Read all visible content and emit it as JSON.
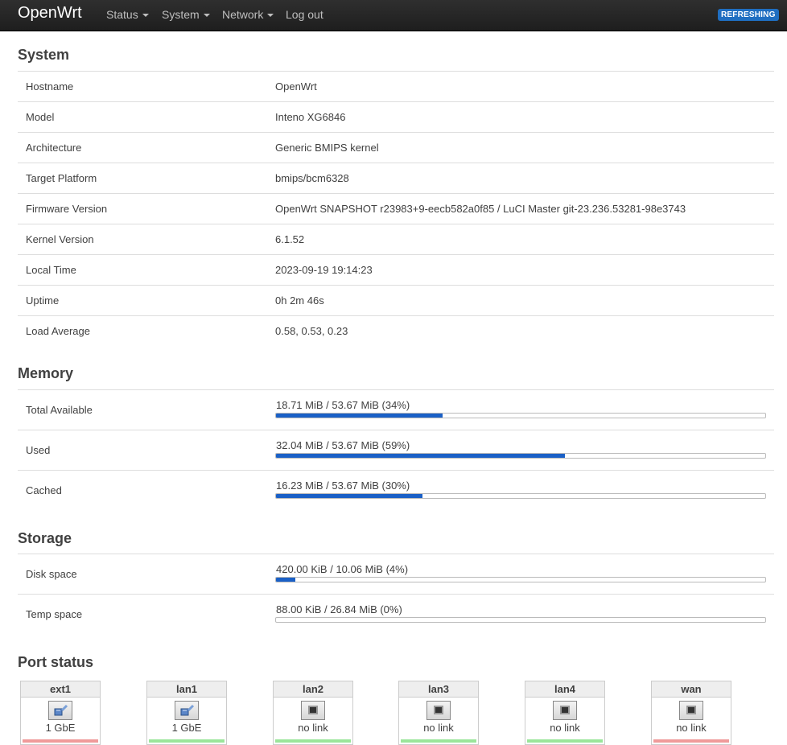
{
  "brand": "OpenWrt",
  "nav": {
    "status": "Status",
    "system": "System",
    "network": "Network",
    "logout": "Log out"
  },
  "badge": "REFRESHING",
  "system": {
    "title": "System",
    "rows": [
      {
        "key": "Hostname",
        "value": "OpenWrt"
      },
      {
        "key": "Model",
        "value": "Inteno XG6846"
      },
      {
        "key": "Architecture",
        "value": "Generic BMIPS kernel"
      },
      {
        "key": "Target Platform",
        "value": "bmips/bcm6328"
      },
      {
        "key": "Firmware Version",
        "value": "OpenWrt SNAPSHOT r23983+9-eecb582a0f85 / LuCI Master git-23.236.53281-98e3743"
      },
      {
        "key": "Kernel Version",
        "value": "6.1.52"
      },
      {
        "key": "Local Time",
        "value": "2023-09-19 19:14:23"
      },
      {
        "key": "Uptime",
        "value": "0h 2m 46s"
      },
      {
        "key": "Load Average",
        "value": "0.58, 0.53, 0.23"
      }
    ]
  },
  "memory": {
    "title": "Memory",
    "rows": [
      {
        "key": "Total Available",
        "value": "18.71 MiB / 53.67 MiB (34%)",
        "fraction": 0.34
      },
      {
        "key": "Used",
        "value": "32.04 MiB / 53.67 MiB (59%)",
        "fraction": 0.59
      },
      {
        "key": "Cached",
        "value": "16.23 MiB / 53.67 MiB (30%)",
        "fraction": 0.3
      }
    ]
  },
  "storage": {
    "title": "Storage",
    "rows": [
      {
        "key": "Disk space",
        "value": "420.00 KiB / 10.06 MiB (4%)",
        "fraction": 0.04
      },
      {
        "key": "Temp space",
        "value": "88.00 KiB / 26.84 MiB (0%)",
        "fraction": 0.0
      }
    ]
  },
  "ports": {
    "title": "Port status",
    "items": [
      {
        "name": "ext1",
        "speed": "1 GbE",
        "icon": "ethernet-connected-icon",
        "status_color": "#f09a9a"
      },
      {
        "name": "lan1",
        "speed": "1 GbE",
        "icon": "ethernet-connected-icon",
        "status_color": "#9ae59a"
      },
      {
        "name": "lan2",
        "speed": "no link",
        "icon": "ethernet-disconnected-icon",
        "status_color": "#9ae59a"
      },
      {
        "name": "lan3",
        "speed": "no link",
        "icon": "ethernet-disconnected-icon",
        "status_color": "#9ae59a"
      },
      {
        "name": "lan4",
        "speed": "no link",
        "icon": "ethernet-disconnected-icon",
        "status_color": "#9ae59a"
      },
      {
        "name": "wan",
        "speed": "no link",
        "icon": "ethernet-disconnected-icon",
        "status_color": "#f09a9a"
      }
    ]
  },
  "colors": {
    "accent": "#1a60c6",
    "badge": "#1f6ec1"
  }
}
